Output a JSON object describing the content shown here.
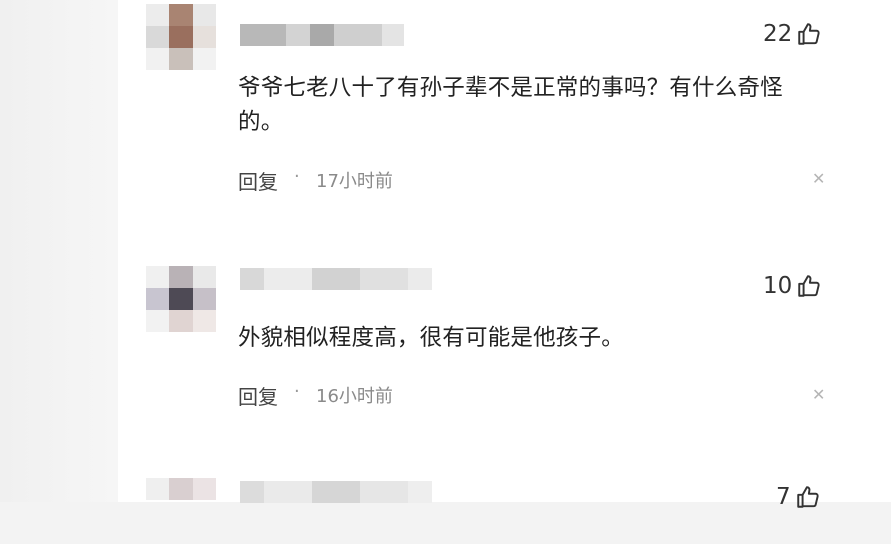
{
  "comments": [
    {
      "likes": "22",
      "text": "爷爷七老八十了有孙子辈不是正常的事吗？有什么奇怪的。",
      "reply_label": "回复",
      "time": "17小时前",
      "colors": {
        "avatar_main": "#9a6f5e"
      }
    },
    {
      "likes": "10",
      "text": "外貌相似程度高，很有可能是他孩子。",
      "reply_label": "回复",
      "time": "16小时前",
      "colors": {
        "avatar_main": "#4e4a55"
      }
    },
    {
      "likes": "7"
    }
  ],
  "icons": {
    "like": "thumbs-up-icon",
    "dismiss": "close-icon"
  }
}
